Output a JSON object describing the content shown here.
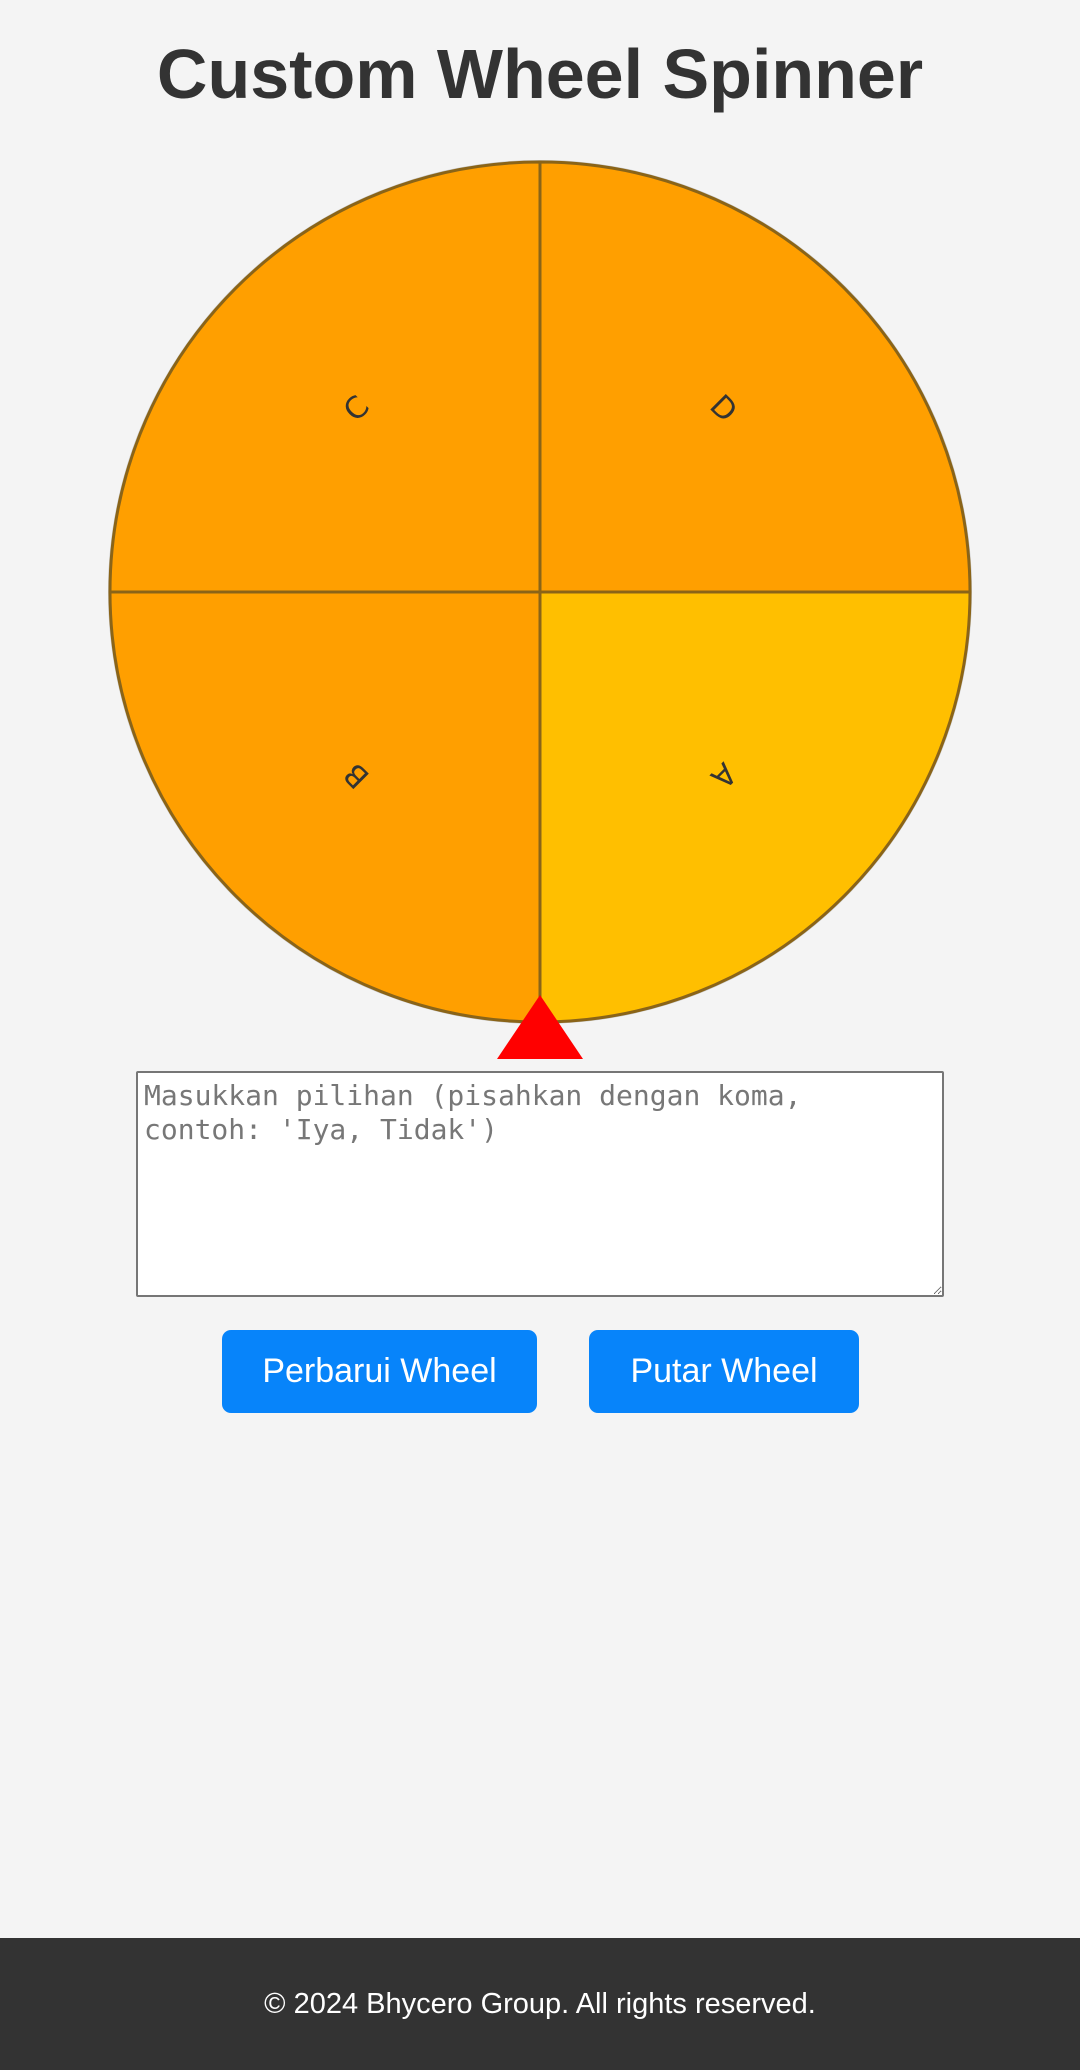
{
  "page": {
    "title": "Custom Wheel Spinner"
  },
  "wheel": {
    "segments": [
      {
        "label": "A",
        "color": "#ffbf00",
        "highlighted": true
      },
      {
        "label": "B",
        "color": "#ff9f00",
        "highlighted": false
      },
      {
        "label": "C",
        "color": "#ff9f00",
        "highlighted": false
      },
      {
        "label": "D",
        "color": "#ff9f00",
        "highlighted": false
      }
    ],
    "border_color": "#c8c8c8",
    "divider_color": "#8a6418",
    "pointer_color": "#ff0000"
  },
  "input": {
    "placeholder": "Masukkan pilihan (pisahkan dengan koma, contoh: 'Iya, Tidak')",
    "value": ""
  },
  "buttons": {
    "update_label": "Perbarui Wheel",
    "spin_label": "Putar Wheel",
    "color": "#0784fa"
  },
  "footer": {
    "text": "© 2024 Bhycero Group. All rights reserved."
  }
}
